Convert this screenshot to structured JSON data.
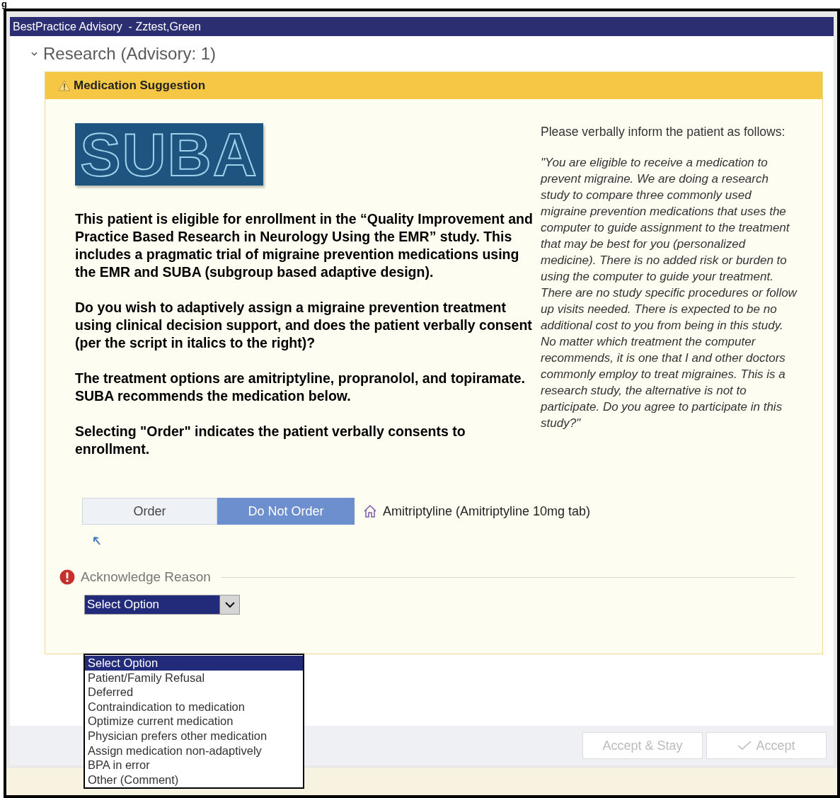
{
  "figure_label": "g",
  "window": {
    "title": "BestPractice Advisory  - Zztest,Green"
  },
  "section": {
    "title": "Research (Advisory: 1)",
    "expanded": true
  },
  "advisory": {
    "title": "Medication Suggestion",
    "logo": "SUBA",
    "paragraphs": [
      "This patient is eligible for enrollment in the “Quality Improvement and Practice Based Research in Neurology Using the EMR” study.  This includes a pragmatic trial of migraine prevention medications using the EMR and SUBA (subgroup based adaptive design).",
      "Do you wish to adaptively assign a migraine prevention treatment using clinical decision support, and does the patient verbally consent (per the script in italics to the right)?",
      "The treatment options are amitriptyline, propranolol, and topiramate. SUBA recommends the medication below.",
      "Selecting \"Order\" indicates the patient verbally consents to enrollment."
    ],
    "script_intro": "Please verbally inform the patient as follows:",
    "script": "\"You are eligible to receive a medication to prevent migraine. We are doing a research study to compare three commonly used migraine prevention medications that uses the computer to guide assignment to the treatment that may be best for you (personalized medicine). There is no added risk or burden to using the computer to guide your treatment. There are no study specific procedures or follow up visits needed. There is expected to be no additional cost to you from being in this study. No matter which treatment the computer recommends, it is one that I and other doctors commonly employ to treat migraines. This is a research study, the alternative is not to participate. Do you agree to participate in this study?\"",
    "order_options": [
      {
        "label": "Order",
        "selected": false
      },
      {
        "label": "Do Not Order",
        "selected": true
      }
    ],
    "medication": "Amitriptyline (Amitriptyline 10mg tab)",
    "acknowledge": {
      "label": "Acknowledge Reason",
      "required": true,
      "value": "Select Option",
      "expanded": true,
      "options": [
        {
          "label": "Select Option",
          "selected": true
        },
        {
          "label": "Patient/Family Refusal",
          "selected": false
        },
        {
          "label": "Deferred",
          "selected": false
        },
        {
          "label": "Contraindication to medication",
          "selected": false
        },
        {
          "label": "Optimize current medication",
          "selected": false
        },
        {
          "label": "Physician prefers other medication",
          "selected": false
        },
        {
          "label": "Assign medication non-adaptively",
          "selected": false
        },
        {
          "label": "BPA in error",
          "selected": false
        },
        {
          "label": "Other (Comment)",
          "selected": false
        }
      ]
    }
  },
  "footer_buttons": [
    {
      "label": "Accept & Stay",
      "kind": "plain",
      "disabled": true
    },
    {
      "label": "Accept",
      "kind": "check",
      "disabled": true
    }
  ]
}
